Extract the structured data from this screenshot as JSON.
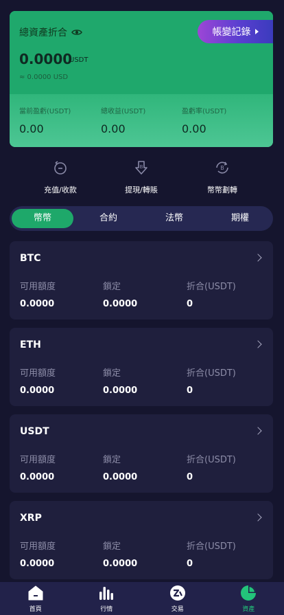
{
  "summary": {
    "total_label": "總資產折合",
    "total_value": "0.0000",
    "total_unit": "USDT",
    "total_usd": "≈ 0.0000 USD",
    "records_button": "帳變記錄",
    "stats": [
      {
        "label": "當前盈虧(USDT)",
        "value": "0.00"
      },
      {
        "label": "總收益(USDT)",
        "value": "0.00"
      },
      {
        "label": "盈虧率(USDT)",
        "value": "0.00"
      }
    ]
  },
  "actions": [
    {
      "label": "充值/收款",
      "icon": "deposit-icon"
    },
    {
      "label": "提現/轉賬",
      "icon": "withdraw-icon"
    },
    {
      "label": "幣幣劃轉",
      "icon": "transfer-icon"
    }
  ],
  "tabs": [
    {
      "label": "幣幣",
      "active": true
    },
    {
      "label": "合約",
      "active": false
    },
    {
      "label": "法幣",
      "active": false
    },
    {
      "label": "期權",
      "active": false
    }
  ],
  "column_labels": {
    "available": "可用額度",
    "locked": "鎖定",
    "converted": "折合(USDT)"
  },
  "coins": [
    {
      "name": "BTC",
      "available": "0.0000",
      "locked": "0.0000",
      "converted": "0"
    },
    {
      "name": "ETH",
      "available": "0.0000",
      "locked": "0.0000",
      "converted": "0"
    },
    {
      "name": "USDT",
      "available": "0.0000",
      "locked": "0.0000",
      "converted": "0"
    },
    {
      "name": "XRP",
      "available": "0.0000",
      "locked": "0.0000",
      "converted": "0"
    }
  ],
  "bottom_nav": [
    {
      "label": "首頁",
      "icon": "home-icon"
    },
    {
      "label": "行情",
      "icon": "market-icon"
    },
    {
      "label": "交易",
      "icon": "trade-icon"
    },
    {
      "label": "資產",
      "icon": "assets-icon",
      "active": true
    }
  ],
  "colors": {
    "accent_green": "#1fa86c",
    "background": "#15152e",
    "card": "#1f1f3d",
    "records_gradient_start": "#9d46d6"
  }
}
